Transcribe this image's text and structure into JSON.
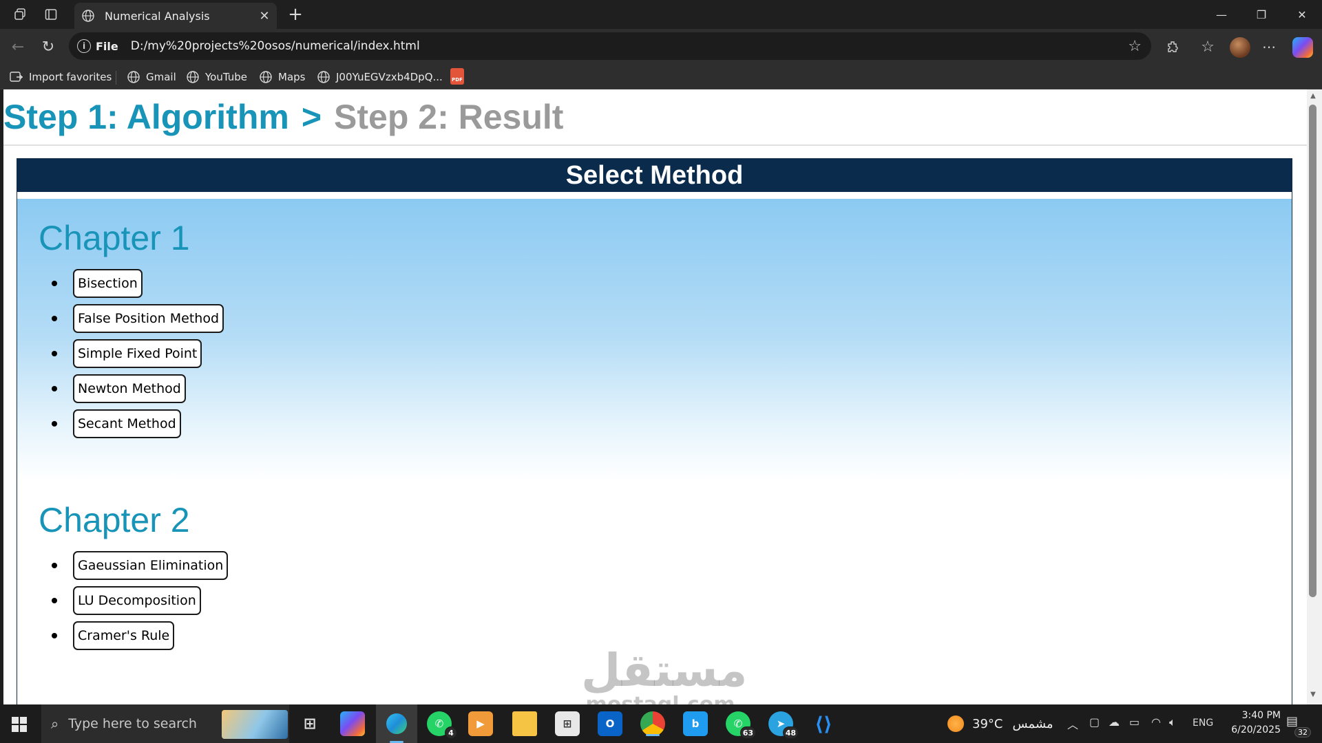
{
  "browser": {
    "tab_title": "Numerical Analysis",
    "address_scheme": "File",
    "address_url": "D:/my%20projects%20osos/numerical/index.html",
    "bookmarks": [
      {
        "label": "Import favorites"
      },
      {
        "label": "Gmail"
      },
      {
        "label": "YouTube"
      },
      {
        "label": "Maps"
      },
      {
        "label": "J00YuEGVzxb4DpQ..."
      }
    ],
    "pdf_label": "PDF"
  },
  "page": {
    "breadcrumb": {
      "step1": "Step 1: Algorithm",
      "separator": ">",
      "step2": "Step 2: Result"
    },
    "panel_title": "Select Method",
    "chapters": [
      {
        "title": "Chapter 1",
        "methods": [
          "Bisection",
          "False Position Method",
          "Simple Fixed Point",
          "Newton Method",
          "Secant Method"
        ]
      },
      {
        "title": "Chapter 2",
        "methods": [
          "Gaeussian Elimination",
          "LU Decomposition",
          "Cramer's Rule"
        ]
      }
    ]
  },
  "watermark": {
    "arabic": "مستقل",
    "latin": "mostaql.com"
  },
  "taskbar": {
    "search_placeholder": "Type here to search",
    "apps": [
      {
        "icon": "task-view-icon",
        "badge": ""
      },
      {
        "icon": "copilot-icon",
        "badge": ""
      },
      {
        "icon": "edge-icon",
        "badge": ""
      },
      {
        "icon": "whatsapp-icon",
        "badge": "4"
      },
      {
        "icon": "media-player-icon",
        "badge": ""
      },
      {
        "icon": "file-explorer-icon",
        "badge": ""
      },
      {
        "icon": "microsoft-store-icon",
        "badge": ""
      },
      {
        "icon": "outlook-icon",
        "badge": ""
      },
      {
        "icon": "chrome-icon",
        "badge": ""
      },
      {
        "icon": "bluesky-icon",
        "badge": ""
      },
      {
        "icon": "whatsapp-business-icon",
        "badge": "63"
      },
      {
        "icon": "telegram-icon",
        "badge": "48"
      },
      {
        "icon": "vscode-icon",
        "badge": ""
      }
    ],
    "weather_temp": "39°C",
    "weather_condition": "مشمس",
    "language": "ENG",
    "time": "3:40 PM",
    "date": "6/20/2025",
    "notification_count": "32"
  },
  "colors": {
    "accent": "#1894b8",
    "inactive_step": "#9a9a9a",
    "panel_header": "#0a2b4b",
    "gradient_top": "#8ccaf2"
  }
}
